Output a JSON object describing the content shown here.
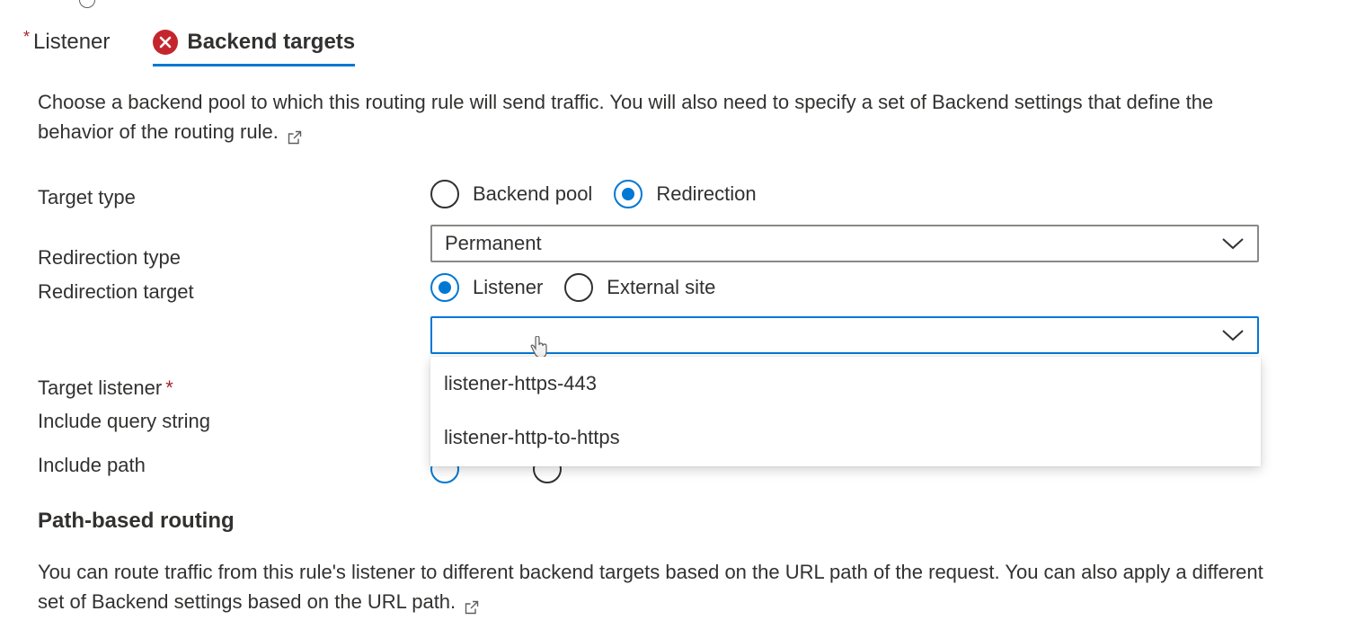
{
  "tabs": {
    "listener_required_mark": "*",
    "listener_label": "Listener",
    "backend_label": "Backend targets"
  },
  "description": "Choose a backend pool to which this routing rule will send traffic. You will also need to specify a set of Backend settings that define the behavior of the routing rule.",
  "target_type": {
    "label": "Target type",
    "options": [
      {
        "label": "Backend pool",
        "checked": false
      },
      {
        "label": "Redirection",
        "checked": true
      }
    ]
  },
  "redirection_type": {
    "label": "Redirection type",
    "value": "Permanent"
  },
  "redirection_target": {
    "label": "Redirection target",
    "options": [
      {
        "label": "Listener",
        "checked": true
      },
      {
        "label": "External site",
        "checked": false
      }
    ]
  },
  "target_listener": {
    "label": "Target listener",
    "required_mark": "*",
    "value": "",
    "dropdown_options": [
      "listener-https-443",
      "listener-http-to-https"
    ]
  },
  "include_query_string": {
    "label": "Include query string"
  },
  "include_path": {
    "label": "Include path"
  },
  "path_based_routing": {
    "title": "Path-based routing",
    "description": "You can route traffic from this rule's listener to different backend targets based on the URL path of the request. You can also apply a different set of Backend settings based on the URL path."
  },
  "colors": {
    "accent": "#0078d4",
    "error": "#c4262e",
    "text": "#323130",
    "required": "#a4262c"
  }
}
